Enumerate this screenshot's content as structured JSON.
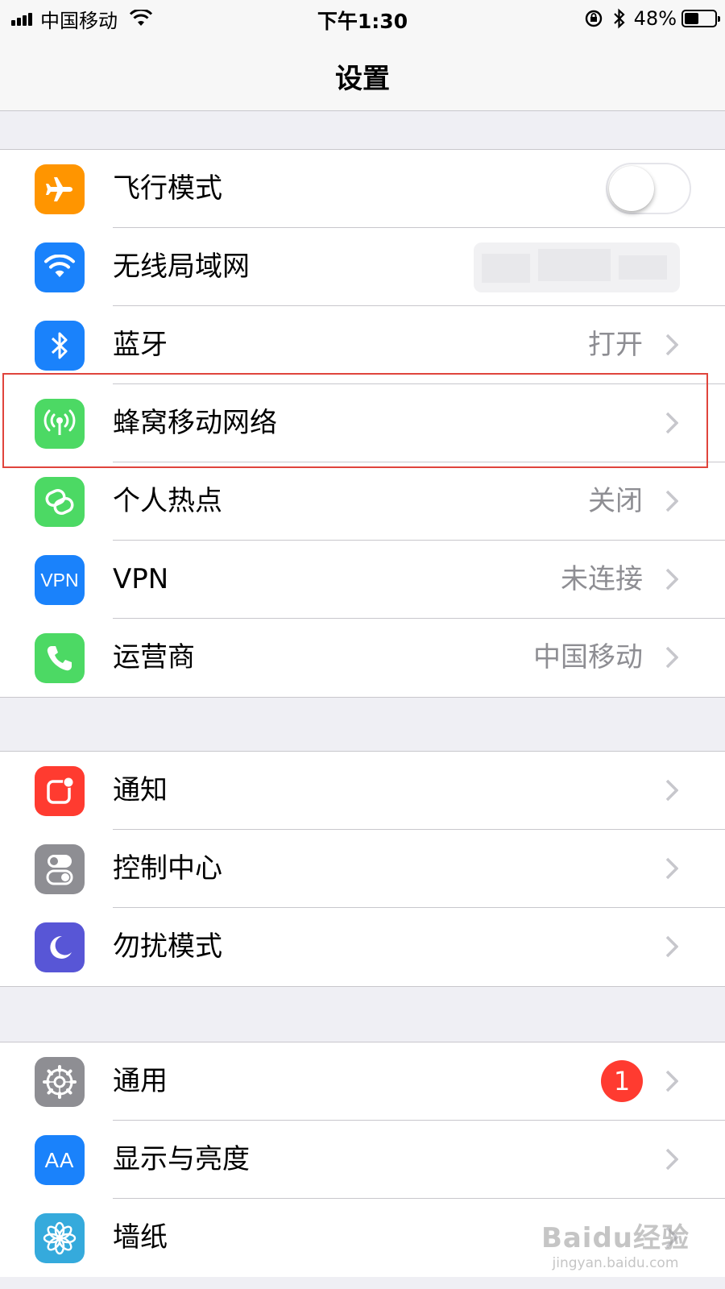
{
  "status_bar": {
    "carrier": "中国移动",
    "time": "下午1:30",
    "battery_percent": "48%",
    "battery_level": 0.48,
    "icons": [
      "signal-icon",
      "wifi-icon",
      "orientation-lock-icon",
      "bluetooth-icon",
      "battery-icon"
    ]
  },
  "nav": {
    "title": "设置"
  },
  "groups": [
    {
      "items": [
        {
          "label": "飞行模式",
          "icon": "airplane-icon",
          "color": "#ff9500",
          "control": "toggle",
          "toggle_on": false
        },
        {
          "label": "无线局域网",
          "icon": "wifi-icon",
          "color": "#1a82fb",
          "value_obscured": true
        },
        {
          "label": "蓝牙",
          "icon": "bluetooth-icon",
          "color": "#1a82fb",
          "value": "打开"
        },
        {
          "label": "蜂窝移动网络",
          "icon": "cellular-antenna-icon",
          "color": "#4cd964",
          "highlighted": true
        },
        {
          "label": "个人热点",
          "icon": "hotspot-icon",
          "color": "#4cd964",
          "value": "关闭"
        },
        {
          "label": "VPN",
          "icon": "vpn-icon",
          "icon_text": "VPN",
          "color": "#1a82fb",
          "value": "未连接"
        },
        {
          "label": "运营商",
          "icon": "phone-icon",
          "color": "#4cd964",
          "value": "中国移动"
        }
      ]
    },
    {
      "items": [
        {
          "label": "通知",
          "icon": "notifications-icon",
          "color": "#ff3b30"
        },
        {
          "label": "控制中心",
          "icon": "control-center-icon",
          "color": "#8e8e93"
        },
        {
          "label": "勿扰模式",
          "icon": "moon-icon",
          "color": "#5856d6"
        }
      ]
    },
    {
      "items": [
        {
          "label": "通用",
          "icon": "gear-icon",
          "color": "#8e8e93",
          "badge": "1"
        },
        {
          "label": "显示与亮度",
          "icon": "display-brightness-icon",
          "icon_text": "AA",
          "color": "#1a82fb"
        },
        {
          "label": "墙纸",
          "icon": "wallpaper-flower-icon",
          "color": "#35aadc"
        }
      ]
    }
  ],
  "watermark": {
    "logo": "Baidu经验",
    "url": "jingyan.baidu.com"
  }
}
